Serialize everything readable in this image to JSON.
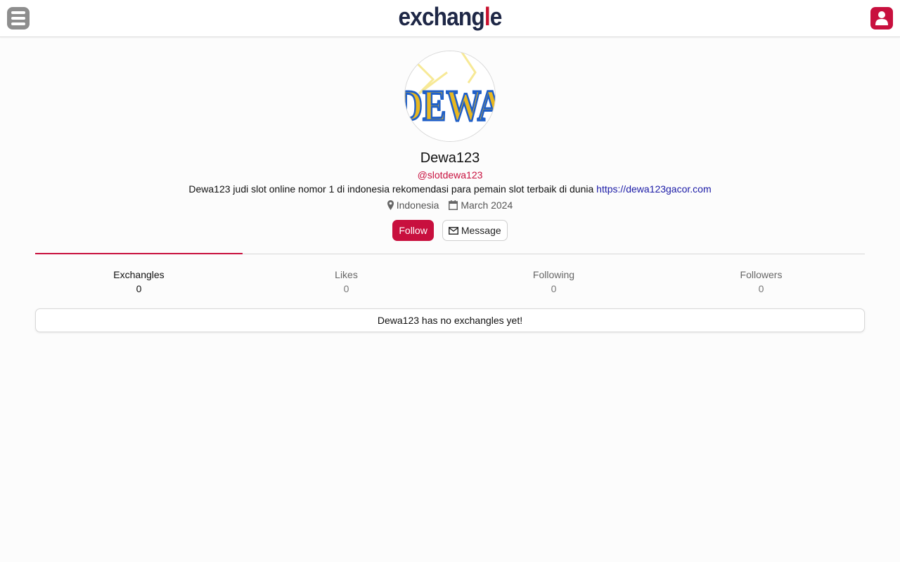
{
  "header": {
    "logo_main": "exchang",
    "logo_accent": "l",
    "logo_end": "e"
  },
  "profile": {
    "avatar_text": "DEWA",
    "display_name": "Dewa123",
    "handle": "@slotdewa123",
    "bio_text": "Dewa123 judi slot online nomor 1 di indonesia rekomendasi para pemain slot terbaik di dunia",
    "bio_link": "https://dewa123gacor.com",
    "location": "Indonesia",
    "joined": "March 2024"
  },
  "actions": {
    "follow_label": "Follow",
    "message_label": "Message"
  },
  "tabs": [
    {
      "label": "Exchangles",
      "count": "0"
    },
    {
      "label": "Likes",
      "count": "0"
    },
    {
      "label": "Following",
      "count": "0"
    },
    {
      "label": "Followers",
      "count": "0"
    }
  ],
  "empty_message": "Dewa123 has no exchangles yet!",
  "colors": {
    "accent": "#c8103e",
    "logo_dark": "#1e2746",
    "link": "#1a1aa6"
  }
}
